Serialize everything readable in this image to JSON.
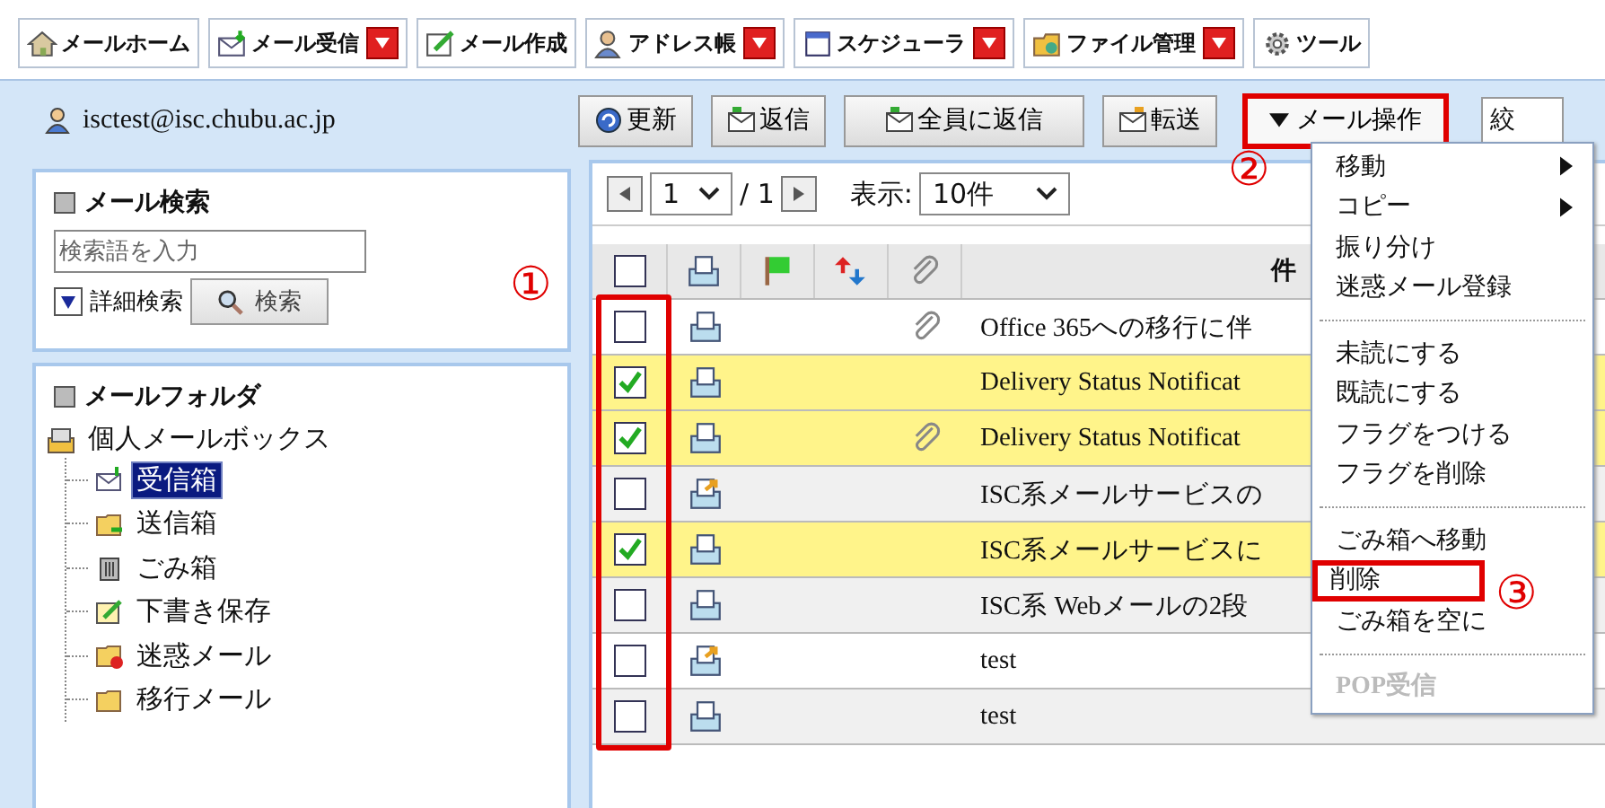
{
  "tabs": [
    {
      "label": "メールホーム",
      "dropdown": false
    },
    {
      "label": "メール受信",
      "dropdown": true
    },
    {
      "label": "メール作成",
      "dropdown": false
    },
    {
      "label": "アドレス帳",
      "dropdown": true
    },
    {
      "label": "スケジューラ",
      "dropdown": true
    },
    {
      "label": "ファイル管理",
      "dropdown": true
    },
    {
      "label": "ツール",
      "dropdown": false
    }
  ],
  "user": "isctest@isc.chubu.ac.jp",
  "toolbar": [
    "更新",
    "返信",
    "全員に返信",
    "転送"
  ],
  "mail_ops": {
    "label": "メール操作",
    "highlighted": true
  },
  "filter_field": {
    "value": "絞"
  },
  "search": {
    "title": "メール検索",
    "placeholder": "検索語を入力",
    "advanced": "詳細検索",
    "button": "検索"
  },
  "folders": {
    "title": "メールフォルダ",
    "root": {
      "label": "個人メールボックス",
      "children": [
        {
          "label": "受信箱",
          "selected": true
        },
        {
          "label": "送信箱",
          "selected": false
        },
        {
          "label": "ごみ箱",
          "selected": false
        },
        {
          "label": "下書き保存",
          "selected": false
        },
        {
          "label": "迷惑メール",
          "selected": false
        },
        {
          "label": "移行メール",
          "selected": false
        }
      ]
    }
  },
  "pager": {
    "page": "1",
    "total": "/ 1",
    "display_label": "表示:",
    "per_page": "10件"
  },
  "table": {
    "checkbox_column_highlighted": true,
    "header_all_checked": false,
    "subject_heading": "件",
    "rows": [
      {
        "checked": false,
        "kind": "read",
        "attachment": true,
        "subject": "Office 365への移行に伴"
      },
      {
        "checked": true,
        "kind": "read",
        "attachment": false,
        "subject": "Delivery Status Notificat"
      },
      {
        "checked": true,
        "kind": "read",
        "attachment": true,
        "subject": "Delivery Status Notificat"
      },
      {
        "checked": false,
        "kind": "replied",
        "attachment": false,
        "subject": "ISC系メールサービスの"
      },
      {
        "checked": true,
        "kind": "read",
        "attachment": false,
        "subject": "ISC系メールサービスに"
      },
      {
        "checked": false,
        "kind": "read",
        "attachment": false,
        "subject": "ISC系 Webメールの2段"
      },
      {
        "checked": false,
        "kind": "replied",
        "attachment": false,
        "subject": "test"
      },
      {
        "checked": false,
        "kind": "read",
        "attachment": false,
        "subject": "test"
      }
    ]
  },
  "menu": [
    {
      "kind": "item",
      "label": "移動",
      "submenu": true,
      "disabled": false,
      "highlighted": false
    },
    {
      "kind": "item",
      "label": "コピー",
      "submenu": true,
      "disabled": false,
      "highlighted": false
    },
    {
      "kind": "item",
      "label": "振り分け",
      "submenu": false,
      "disabled": false,
      "highlighted": false
    },
    {
      "kind": "item",
      "label": "迷惑メール登録",
      "submenu": false,
      "disabled": false,
      "highlighted": false
    },
    {
      "kind": "separator"
    },
    {
      "kind": "item",
      "label": "未読にする",
      "submenu": false,
      "disabled": false,
      "highlighted": false
    },
    {
      "kind": "item",
      "label": "既読にする",
      "submenu": false,
      "disabled": false,
      "highlighted": false
    },
    {
      "kind": "item",
      "label": "フラグをつける",
      "submenu": false,
      "disabled": false,
      "highlighted": false
    },
    {
      "kind": "item",
      "label": "フラグを削除",
      "submenu": false,
      "disabled": false,
      "highlighted": false
    },
    {
      "kind": "separator"
    },
    {
      "kind": "item",
      "label": "ごみ箱へ移動",
      "submenu": false,
      "disabled": false,
      "highlighted": false
    },
    {
      "kind": "item",
      "label": "削除",
      "submenu": false,
      "disabled": false,
      "highlighted": true
    },
    {
      "kind": "item",
      "label": "ごみ箱を空に",
      "submenu": false,
      "disabled": false,
      "highlighted": false
    },
    {
      "kind": "separator"
    },
    {
      "kind": "item",
      "label": "POP受信",
      "submenu": false,
      "disabled": true,
      "highlighted": false
    }
  ],
  "callouts": [
    "①",
    "②",
    "③"
  ]
}
